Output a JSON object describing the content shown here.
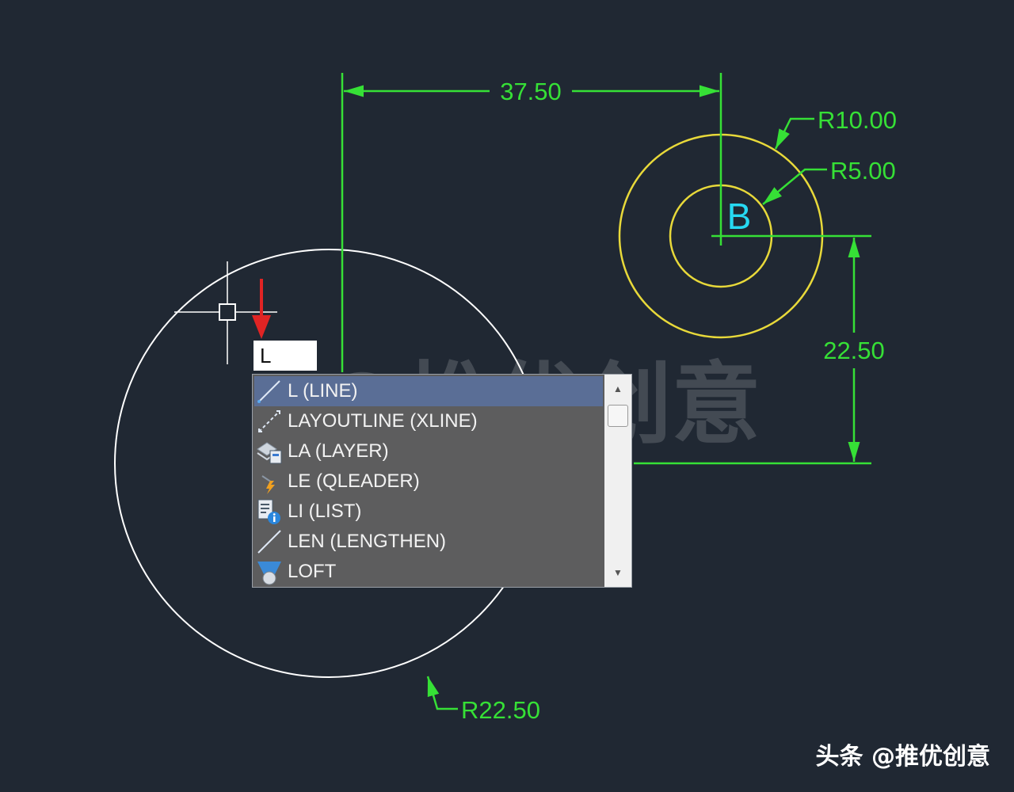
{
  "drawing": {
    "dimensions": {
      "horizontal": "37.50",
      "vertical": "22.50",
      "outer_radius": "R10.00",
      "inner_radius": "R5.00",
      "large_radius": "R22.50"
    },
    "point_label": "B",
    "colors": {
      "background": "#202833",
      "dimension": "#36e036",
      "circle_small": "#e8d93a",
      "circle_large": "#ffffff",
      "label": "#26d9f2",
      "arrow": "#e02424"
    }
  },
  "command_input": {
    "value": "L"
  },
  "autocomplete": {
    "items": [
      {
        "label": "L (LINE)",
        "icon": "line-icon"
      },
      {
        "label": "LAYOUTLINE (XLINE)",
        "icon": "xline-icon"
      },
      {
        "label": "LA (LAYER)",
        "icon": "layer-icon"
      },
      {
        "label": "LE (QLEADER)",
        "icon": "qleader-icon"
      },
      {
        "label": "LI (LIST)",
        "icon": "list-icon"
      },
      {
        "label": "LEN (LENGTHEN)",
        "icon": "lengthen-icon"
      },
      {
        "label": "LOFT",
        "icon": "loft-icon"
      }
    ],
    "selected_index": 0
  },
  "watermark": "@推优创意",
  "footer": "头条 @推优创意"
}
